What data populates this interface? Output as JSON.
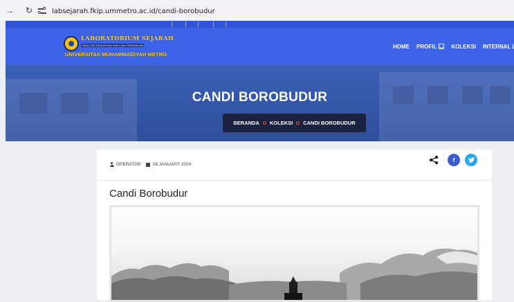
{
  "browser": {
    "url": "labsejarah.fkip.ummetro.ac.id/candi-borobudur"
  },
  "header": {
    "logo_title": "LABORATORIUM SEJARAH",
    "logo_subtitle": "FAKULTAS KEGURUAN DAN ILMU PENDIDIKAN",
    "logo_university": "UNIVERSITAS MUHAMMADIYAH METRO",
    "nav": {
      "home": "HOME",
      "profil": "PROFIL",
      "koleksi": "KOLEKSI",
      "internal": "INTERNAL LI"
    }
  },
  "hero": {
    "title": "CANDI BOROBUDUR",
    "breadcrumb": {
      "home": "BERANDA",
      "section": "KOLEKSI",
      "current": "CANDI BOROBUDUR"
    }
  },
  "post": {
    "author": "OPERATOR",
    "date": "08 JANUARY 2024",
    "title": "Candi Borobudur",
    "share": {
      "facebook": "f",
      "twitter": "t"
    }
  },
  "colors": {
    "header_blue": "#3d63e8",
    "breadcrumb_bg": "#1a2240",
    "breadcrumb_sep": "#e25b2e",
    "facebook": "#3b5ccf",
    "twitter": "#29a8e8"
  }
}
